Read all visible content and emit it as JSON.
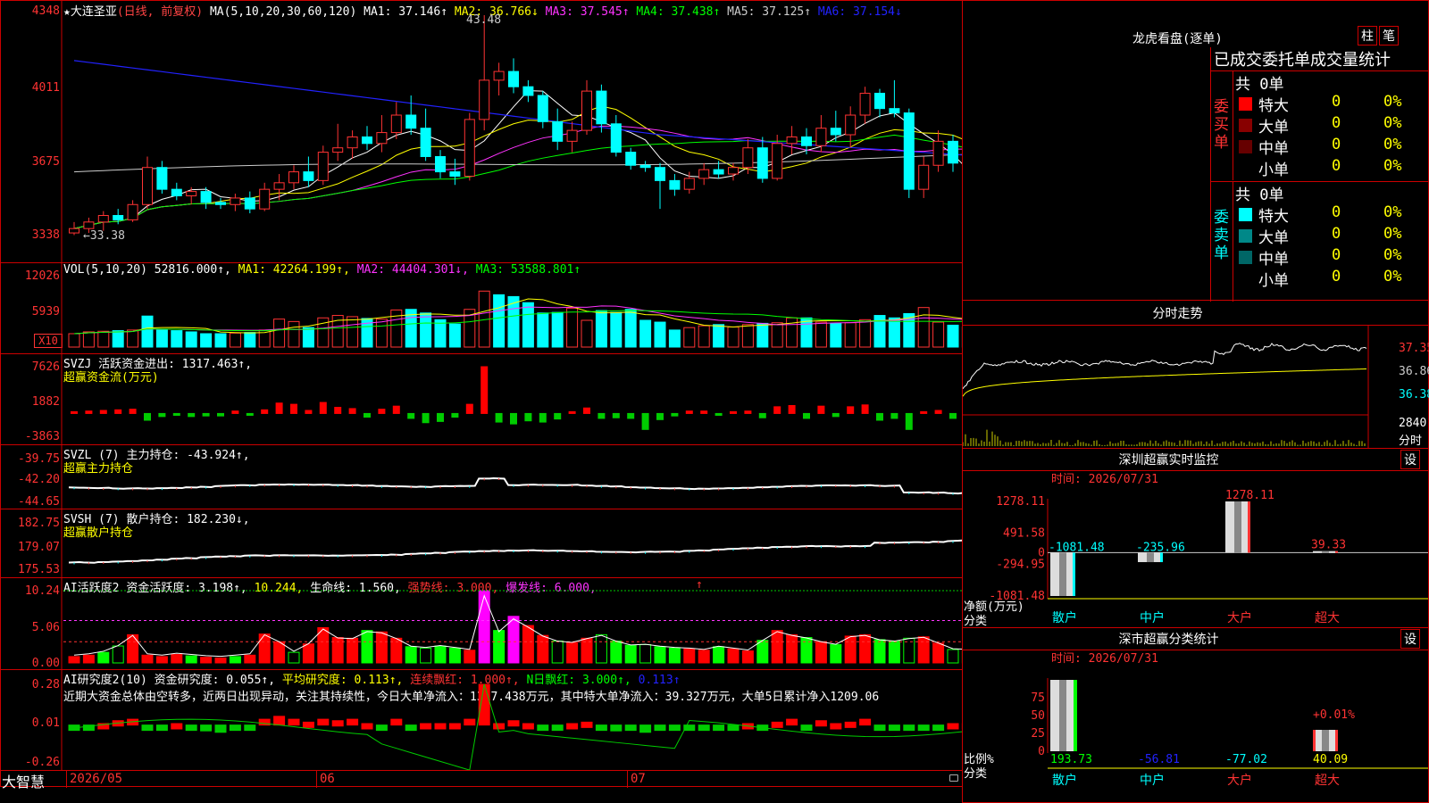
{
  "stock": {
    "name": "★大连圣亚",
    "mode": "(日线, 前复权)"
  },
  "price_panel": {
    "ma_header": [
      {
        "t": "MA(5,10,20,30,60,120)",
        "c": "#fff"
      },
      {
        "t": "MA1: 37.146↑",
        "c": "#fff"
      },
      {
        "t": "MA2: 36.766↓",
        "c": "#ff0"
      },
      {
        "t": "MA3: 37.545↑",
        "c": "#f3f"
      },
      {
        "t": "MA4: 37.438↑",
        "c": "#0f0"
      },
      {
        "t": "MA5: 37.125↑",
        "c": "#ccc"
      },
      {
        "t": "MA6: 37.154↓",
        "c": "#22f"
      }
    ],
    "y_labels": [
      "4348",
      "4011",
      "3675",
      "3338"
    ],
    "high_note": "43.48",
    "low_note": "←33.38"
  },
  "vol_panel": {
    "header": [
      {
        "t": "VOL(5,10,20)",
        "c": "#fff"
      },
      {
        "t": "52816.000↑,",
        "c": "#fff"
      },
      {
        "t": "MA1: 42264.199↑,",
        "c": "#ff0"
      },
      {
        "t": "MA2: 44404.301↓,",
        "c": "#f3f"
      },
      {
        "t": "MA3: 53588.801↑",
        "c": "#0f0"
      }
    ],
    "y_labels": [
      "12026",
      "5939"
    ],
    "unit": "X10"
  },
  "svzj_panel": {
    "header": [
      {
        "t": "SVZJ",
        "c": "#fff"
      },
      {
        "t": "活跃资金进出: 1317.463↑,",
        "c": "#fff"
      }
    ],
    "sub": "超赢资金流(万元)",
    "y_labels": [
      "7626",
      "1882",
      "-3863"
    ]
  },
  "svzl_panel": {
    "header": [
      {
        "t": "SVZL (7)",
        "c": "#fff"
      },
      {
        "t": "主力持仓: -43.924↑,",
        "c": "#fff"
      }
    ],
    "sub": "超赢主力持仓",
    "y_labels": [
      "-39.75",
      "-42.20",
      "-44.65"
    ]
  },
  "svsh_panel": {
    "header": [
      {
        "t": "SVSH (7)",
        "c": "#fff"
      },
      {
        "t": "散户持仓: 182.230↓,",
        "c": "#fff"
      }
    ],
    "sub": "超赢散户持仓",
    "y_labels": [
      "182.75",
      "179.07",
      "175.53"
    ]
  },
  "ai_active_panel": {
    "header": [
      {
        "t": "AI活跃度2",
        "c": "#fff"
      },
      {
        "t": "资金活跃度: 3.198↑,",
        "c": "#fff"
      },
      {
        "t": "10.244,",
        "c": "#ff0"
      },
      {
        "t": "生命线: 1.560,",
        "c": "#fff"
      },
      {
        "t": "强势线: 3.000,",
        "c": "#f33"
      },
      {
        "t": "爆发线: 6.000,",
        "c": "#f3f"
      }
    ],
    "arrow": "↑",
    "y_labels": [
      "10.24",
      "5.06",
      "0.00"
    ]
  },
  "ai_research_panel": {
    "header": [
      {
        "t": "AI研究度2(10)",
        "c": "#fff"
      },
      {
        "t": "资金研究度: 0.055↑,",
        "c": "#fff"
      },
      {
        "t": "平均研究度: 0.113↑,",
        "c": "#ff0"
      },
      {
        "t": "连续飘红: 1.000↑,",
        "c": "#f33"
      },
      {
        "t": "N日飘红: 3.000↑,",
        "c": "#0f0"
      },
      {
        "t": "0.113↑",
        "c": "#22f"
      }
    ],
    "note": "近期大资金总体由空转多，近两日出现异动，关注其持续性，今日大单净流入：1317.438万元，其中特大单净流入：39.327万元，大单5日累计净入1209.06",
    "y_labels": [
      "0.28",
      "0.01",
      "-0.26"
    ]
  },
  "x_axis": {
    "labels": [
      "2026/05",
      "06",
      "07"
    ],
    "brand": "大智慧"
  },
  "dragon": {
    "title": "龙虎看盘(逐单)",
    "btn1": "柱",
    "btn2": "笔",
    "table_title": "已成交委托单成交量统计",
    "buy": {
      "side": "委买单",
      "total": "共 0单",
      "rows": [
        {
          "label": "特大",
          "v": "0",
          "p": "0%",
          "c": "#f00"
        },
        {
          "label": "大单",
          "v": "0",
          "p": "0%",
          "c": "#800"
        },
        {
          "label": "中单",
          "v": "0",
          "p": "0%",
          "c": "#600"
        },
        {
          "label": "小单",
          "v": "0",
          "p": "0%",
          "c": "#000"
        }
      ]
    },
    "sell": {
      "side": "委卖单",
      "total": "共 0单",
      "rows": [
        {
          "label": "特大",
          "v": "0",
          "p": "0%",
          "c": "#0ff"
        },
        {
          "label": "大单",
          "v": "0",
          "p": "0%",
          "c": "#088"
        },
        {
          "label": "中单",
          "v": "0",
          "p": "0%",
          "c": "#066"
        },
        {
          "label": "小单",
          "v": "0",
          "p": "0%",
          "c": "#000"
        }
      ]
    }
  },
  "intraday": {
    "title": "分时走势",
    "labels": [
      "37.35",
      "36.86",
      "36.38"
    ],
    "vol_label": "2840",
    "vol_unit": "分时"
  },
  "sz_monitor": {
    "title": "深圳超赢实时监控",
    "btn": "设",
    "time": "时间: 2026/07/31",
    "y_labels": [
      "1278.11",
      "491.58",
      "0",
      "-294.95",
      "-1081.48"
    ],
    "bars": [
      {
        "cat": "散户",
        "val": "-1081.48",
        "n": -1081.48,
        "c": "#0ff"
      },
      {
        "cat": "中户",
        "val": "-235.96",
        "n": -235.96,
        "c": "#0ff"
      },
      {
        "cat": "大户",
        "val": "1278.11",
        "n": 1278.11,
        "c": "#f33"
      },
      {
        "cat": "超大",
        "val": "39.33",
        "n": 39.33,
        "c": "#f33"
      }
    ],
    "ylabel": "净额(万元)",
    "xlabel": "分类"
  },
  "sz_class": {
    "title": "深市超赢分类统计",
    "btn": "设",
    "time": "时间: 2026/07/31",
    "y_labels": [
      "75",
      "50",
      "25",
      "0"
    ],
    "bars": [
      {
        "cat": "散户",
        "val": "193.73",
        "c": "#0f0"
      },
      {
        "cat": "中户",
        "val": "-56.81",
        "c": "#22f"
      },
      {
        "cat": "大户",
        "val": "-77.02",
        "c": "#0ff"
      },
      {
        "cat": "超大",
        "val": "40.09",
        "c": "#ff0"
      }
    ],
    "pct": "+0.01%",
    "ylabel": "比例%",
    "xlabel": "分类"
  },
  "chart_data": [
    {
      "type": "candlestick",
      "title": "大连圣亚",
      "ylim": [
        33.38,
        43.48
      ],
      "y_ticks": [
        43.48,
        40.11,
        36.75,
        33.38
      ],
      "ohlc": [
        [
          33.5,
          34.0,
          33.4,
          33.7
        ],
        [
          33.7,
          34.2,
          33.5,
          34.0
        ],
        [
          34.0,
          34.5,
          33.6,
          34.3
        ],
        [
          34.3,
          34.6,
          33.9,
          34.1
        ],
        [
          34.1,
          35.0,
          34.0,
          34.8
        ],
        [
          34.8,
          37.0,
          34.6,
          36.5
        ],
        [
          36.5,
          36.8,
          35.3,
          35.5
        ],
        [
          35.5,
          35.8,
          35.0,
          35.2
        ],
        [
          35.2,
          35.6,
          34.8,
          35.4
        ],
        [
          35.4,
          35.6,
          34.6,
          34.9
        ],
        [
          34.9,
          35.1,
          34.6,
          34.8
        ],
        [
          34.8,
          35.3,
          34.5,
          35.1
        ],
        [
          35.1,
          35.4,
          34.4,
          34.6
        ],
        [
          34.6,
          35.8,
          34.5,
          35.5
        ],
        [
          35.5,
          36.2,
          35.0,
          35.8
        ],
        [
          35.8,
          36.6,
          35.5,
          36.3
        ],
        [
          36.3,
          37.0,
          35.6,
          35.9
        ],
        [
          35.9,
          37.5,
          35.7,
          37.2
        ],
        [
          37.2,
          38.5,
          36.8,
          37.4
        ],
        [
          37.4,
          38.2,
          36.9,
          37.9
        ],
        [
          37.9,
          38.4,
          37.3,
          37.6
        ],
        [
          37.6,
          38.9,
          37.2,
          38.1
        ],
        [
          38.1,
          39.5,
          37.8,
          38.9
        ],
        [
          38.9,
          39.8,
          38.0,
          38.3
        ],
        [
          38.3,
          39.2,
          36.8,
          37.0
        ],
        [
          37.0,
          37.3,
          36.0,
          36.3
        ],
        [
          36.3,
          36.9,
          35.7,
          36.1
        ],
        [
          36.1,
          39.0,
          35.9,
          38.7
        ],
        [
          38.7,
          43.48,
          38.2,
          40.5
        ],
        [
          40.5,
          41.3,
          39.8,
          40.9
        ],
        [
          40.9,
          41.5,
          39.9,
          40.2
        ],
        [
          40.2,
          40.5,
          39.5,
          39.8
        ],
        [
          39.8,
          40.0,
          38.3,
          38.6
        ],
        [
          38.6,
          39.2,
          37.3,
          37.7
        ],
        [
          37.7,
          38.6,
          37.2,
          38.2
        ],
        [
          38.2,
          40.5,
          38.0,
          40.0
        ],
        [
          40.0,
          40.3,
          38.1,
          38.5
        ],
        [
          38.5,
          38.9,
          37.0,
          37.2
        ],
        [
          37.2,
          37.4,
          36.4,
          36.6
        ],
        [
          36.6,
          36.8,
          36.3,
          36.5
        ],
        [
          36.5,
          36.7,
          34.6,
          35.9
        ],
        [
          35.9,
          36.2,
          35.2,
          35.5
        ],
        [
          35.5,
          36.3,
          35.3,
          36.0
        ],
        [
          36.0,
          36.7,
          35.7,
          36.4
        ],
        [
          36.4,
          36.8,
          36.0,
          36.2
        ],
        [
          36.2,
          36.7,
          35.9,
          36.5
        ],
        [
          36.5,
          37.8,
          36.2,
          37.4
        ],
        [
          37.4,
          37.9,
          35.8,
          36.0
        ],
        [
          36.0,
          38.0,
          35.9,
          37.6
        ],
        [
          37.6,
          38.4,
          37.1,
          37.9
        ],
        [
          37.9,
          38.3,
          37.1,
          37.5
        ],
        [
          37.5,
          38.9,
          37.2,
          38.3
        ],
        [
          38.3,
          39.1,
          37.7,
          38.0
        ],
        [
          38.0,
          39.3,
          37.4,
          38.9
        ],
        [
          38.9,
          40.2,
          38.5,
          39.9
        ],
        [
          39.9,
          40.1,
          38.8,
          39.2
        ],
        [
          39.2,
          40.5,
          38.8,
          39.0
        ],
        [
          39.0,
          39.2,
          35.1,
          35.5
        ],
        [
          35.5,
          37.0,
          35.1,
          36.6
        ],
        [
          36.6,
          38.2,
          36.3,
          37.7
        ],
        [
          37.7,
          38.0,
          36.3,
          36.7
        ],
        [
          36.7,
          37.0,
          35.4,
          35.6
        ],
        [
          35.6,
          36.7,
          35.3,
          36.5
        ],
        [
          36.5,
          37.0,
          35.9,
          36.2
        ],
        [
          36.2,
          37.1,
          35.9,
          36.8
        ],
        [
          36.8,
          37.5,
          36.5,
          37.0
        ],
        [
          37.0,
          37.8,
          36.6,
          37.3
        ],
        [
          37.3,
          38.3,
          36.7,
          36.9
        ],
        [
          36.9,
          37.5,
          35.9,
          37.1
        ]
      ]
    },
    {
      "type": "bar",
      "title": "VOL",
      "unit": "X10",
      "ylim": [
        0,
        12026
      ],
      "values": [
        2200,
        2500,
        2600,
        2700,
        2800,
        5100,
        2800,
        2700,
        2500,
        2200,
        2200,
        2300,
        2400,
        2800,
        4600,
        4200,
        3200,
        4800,
        5200,
        5000,
        4700,
        4600,
        6100,
        6200,
        5600,
        4500,
        3800,
        6200,
        9200,
        8600,
        8300,
        7300,
        5600,
        5700,
        6400,
        4400,
        6000,
        5700,
        6200,
        4400,
        4100,
        2800,
        3200,
        3500,
        3700,
        3300,
        3700,
        3900,
        4000,
        4800,
        4800,
        4100,
        3900,
        4000,
        4500,
        5200,
        4800,
        5500,
        6500,
        4100,
        3600,
        3300,
        3000,
        3200,
        3800,
        3900,
        4200,
        4400,
        4700
      ],
      "up": [
        1,
        1,
        1,
        0,
        1,
        0,
        0,
        0,
        0,
        0,
        0,
        1,
        0,
        1,
        1,
        1,
        0,
        1,
        1,
        1,
        0,
        1,
        1,
        0,
        0,
        0,
        0,
        1,
        1,
        0,
        0,
        0,
        0,
        0,
        1,
        1,
        0,
        0,
        0,
        0,
        0,
        0,
        1,
        1,
        0,
        1,
        1,
        0,
        1,
        1,
        0,
        1,
        0,
        1,
        1,
        0,
        0,
        0,
        1,
        1,
        0,
        0,
        1,
        0,
        1,
        1,
        1,
        0,
        1
      ]
    },
    {
      "type": "bar",
      "title": "超赢资金流(万元)",
      "ylim": [
        -3863,
        7626
      ],
      "values": [
        300,
        400,
        500,
        600,
        700,
        -1100,
        -500,
        -300,
        -500,
        -400,
        -400,
        400,
        -300,
        600,
        1700,
        1500,
        500,
        1800,
        1000,
        800,
        -600,
        700,
        1200,
        -800,
        -1500,
        -1300,
        -600,
        1500,
        7626,
        -1400,
        -1700,
        -1200,
        -1400,
        -900,
        300,
        900,
        -800,
        -700,
        -800,
        -2600,
        -1000,
        -400,
        400,
        400,
        -300,
        300,
        400,
        -700,
        1100,
        1300,
        -800,
        1200,
        -500,
        1100,
        1400,
        -1100,
        -800,
        -2600,
        300,
        500,
        -800,
        -600,
        500,
        -400,
        400,
        400,
        500,
        -300,
        1317
      ]
    },
    {
      "type": "line",
      "title": "超赢主力持仓",
      "ylim": [
        -44.65,
        -39.75
      ]
    },
    {
      "type": "line",
      "title": "超赢散户持仓",
      "ylim": [
        175.53,
        182.75
      ]
    },
    {
      "type": "bar",
      "title": "AI活跃度2",
      "ylim": [
        0,
        10.24
      ],
      "ref_lines": [
        3,
        6,
        10.244
      ],
      "values": [
        0.9,
        1.1,
        1.5,
        2.4,
        4.0,
        1.1,
        0.9,
        1.2,
        1.0,
        0.8,
        0.7,
        0.9,
        1.1,
        4.1,
        3.0,
        1.5,
        2.7,
        5.0,
        3.6,
        3.5,
        4.6,
        4.4,
        3.5,
        2.3,
        2.1,
        2.4,
        2.1,
        1.8,
        10.24,
        4.6,
        6.6,
        5.3,
        3.9,
        3.1,
        2.9,
        3.5,
        4.0,
        3.1,
        2.5,
        2.6,
        2.3,
        2.1,
        2.0,
        1.8,
        2.3,
        2.0,
        1.7,
        3.2,
        4.6,
        4.0,
        3.6,
        3.0,
        2.6,
        3.8,
        4.0,
        3.3,
        3.1,
        3.5,
        3.7,
        2.8,
        1.9,
        1.8,
        1.5,
        1.5,
        1.2,
        1.3,
        1.8,
        2.1,
        3.0
      ],
      "up": [
        1,
        1,
        0,
        0,
        1,
        1,
        1,
        1,
        0,
        1,
        1,
        0,
        1,
        1,
        1,
        0,
        1,
        1,
        1,
        1,
        0,
        1,
        1,
        0,
        0,
        0,
        0,
        1,
        1,
        0,
        1,
        1,
        1,
        0,
        1,
        1,
        0,
        0,
        0,
        0,
        0,
        0,
        1,
        1,
        0,
        1,
        1,
        0,
        1,
        1,
        0,
        1,
        0,
        1,
        1,
        0,
        0,
        0,
        1,
        1,
        0,
        0,
        1,
        0,
        1,
        1,
        1,
        0,
        1
      ]
    },
    {
      "type": "bar",
      "title": "AI研究度2(10)",
      "ylim": [
        -0.26,
        0.28
      ],
      "values": [
        -0.03,
        -0.02,
        0.01,
        0.03,
        0.04,
        -0.03,
        -0.01,
        0.01,
        -0.03,
        -0.04,
        -0.05,
        -0.03,
        -0.02,
        0.04,
        0.06,
        0.04,
        0.02,
        0.04,
        0.03,
        0.04,
        0.01,
        -0.01,
        0.04,
        -0.01,
        0.01,
        0.01,
        0.01,
        0.04,
        0.28,
        0.01,
        0.03,
        0.01,
        -0.02,
        -0.02,
        0.01,
        0.02,
        -0.01,
        -0.04,
        -0.02,
        -0.05,
        -0.02,
        -0.03,
        -0.03,
        -0.02,
        -0.03,
        -0.02,
        0.01,
        -0.03,
        0.02,
        0.04,
        -0.02,
        0.03,
        0.01,
        0.02,
        0.04,
        -0.02,
        -0.01,
        -0.02,
        -0.01,
        -0.01,
        0.01,
        0.01,
        0.01,
        -0.01,
        0.01,
        0.01,
        0.01,
        0.01,
        0.04
      ]
    }
  ]
}
